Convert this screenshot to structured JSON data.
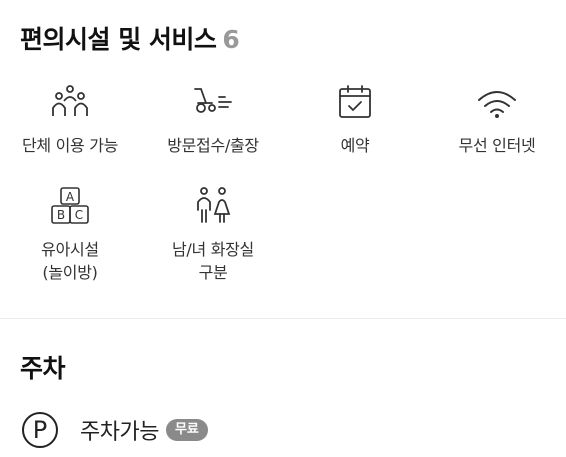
{
  "amenities_section": {
    "title": "편의시설 및 서비스",
    "count": "6",
    "items": [
      {
        "label": "단체 이용 가능",
        "icon": "group-people-icon"
      },
      {
        "label": "방문접수/출장",
        "icon": "delivery-scooter-icon"
      },
      {
        "label": "예약",
        "icon": "calendar-check-icon"
      },
      {
        "label": "무선 인터넷",
        "icon": "wifi-icon"
      },
      {
        "label": "유아시설\n(놀이방)",
        "icon": "abc-blocks-icon"
      },
      {
        "label": "남/녀 화장실\n구분",
        "icon": "restroom-icon"
      }
    ]
  },
  "parking_section": {
    "title": "주차",
    "icon_letter": "P",
    "label": "주차가능",
    "badge": "무료"
  }
}
